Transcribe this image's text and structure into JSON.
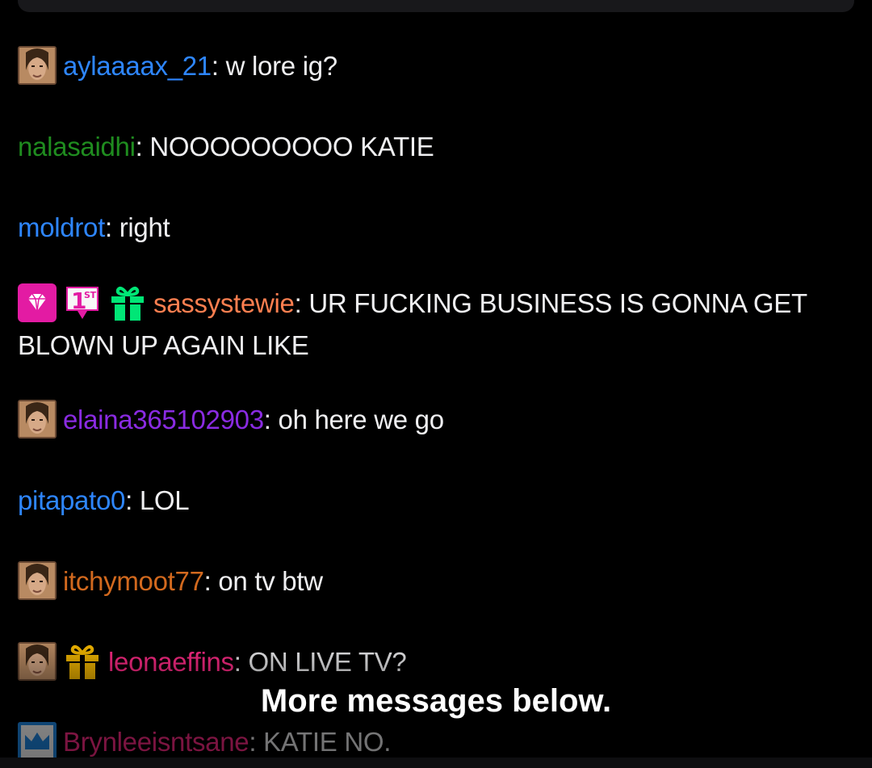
{
  "colors": {
    "background": "#000000",
    "text": "#efeff1",
    "aylaaaax_21": "#2e86ff",
    "nalasaidhi": "#1f8c1f",
    "moldrot": "#2e86ff",
    "sassystewie": "#ff7f50",
    "elaina": "#8a2be2",
    "pitapato0": "#2e86ff",
    "itchymoot77": "#d2691e",
    "leonaeffins": "#ff2a86",
    "brynlee": "#ff2a86"
  },
  "messages": [
    {
      "user": "aylaaaax_21",
      "sep": ": ",
      "text": "w lore ig?",
      "badges": [
        "avatar-badge"
      ]
    },
    {
      "user": "nalasaidhi",
      "sep": ": ",
      "text": "NOOOOOOOOO KATIE",
      "badges": []
    },
    {
      "user": "moldrot",
      "sep": ": ",
      "text": "right",
      "badges": []
    },
    {
      "user": "sassystewie",
      "sep": ": ",
      "text": "UR FUCKING BUSINESS IS GONNA GET BLOWN UP AGAIN LIKE",
      "badges": [
        "diamond-badge",
        "first-badge",
        "gift-badge-green"
      ]
    },
    {
      "user": "elaina365102903",
      "sep": ": ",
      "text": "oh here we go",
      "badges": [
        "avatar-badge"
      ]
    },
    {
      "user": "pitapato0",
      "sep": ": ",
      "text": "LOL",
      "badges": []
    },
    {
      "user": "itchymoot77",
      "sep": ": ",
      "text": "on tv btw",
      "badges": [
        "avatar-badge"
      ]
    },
    {
      "user": "leonaeffins",
      "sep": ": ",
      "text": "ON LIVE TV?",
      "badges": [
        "avatar-badge",
        "gift-badge-gold"
      ]
    },
    {
      "user": "Brynleeisntsane",
      "sep": ": ",
      "text": "KATIE NO.",
      "badges": [
        "crown-badge"
      ]
    }
  ],
  "first_badge_text": "1",
  "first_badge_sup": "ST",
  "more_messages_label": "More messages below."
}
